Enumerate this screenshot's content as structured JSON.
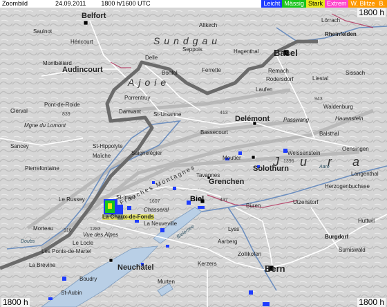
{
  "header": {
    "title": "Zoombild",
    "date": "24.09.2011",
    "time_range": "1800 h/1600 UTC"
  },
  "legend": [
    {
      "label": "Leicht",
      "color": "#1e3cff"
    },
    {
      "label": "Mässig",
      "color": "#16c41a"
    },
    {
      "label": "Stark",
      "color": "#e8e81e"
    },
    {
      "label": "Extrem",
      "color": "#ff44cc"
    },
    {
      "label": "W. Blitze",
      "color": "#ff9900"
    },
    {
      "label": "B.",
      "color": "#ff9900"
    }
  ],
  "corners": {
    "top_right": "1800 h",
    "bottom_left": "1800 h",
    "bottom_right": "1800 h"
  },
  "places": {
    "belfort": "Belfort",
    "basel": "Basel",
    "biel": "Biel",
    "bern": "Bern",
    "delemont": "Delémont",
    "neuchatel": "Neuchâtel",
    "hericourt": "Héricourt",
    "montbeliard": "Montbéliard",
    "audincourt": "Audincourt",
    "porrentruy": "Porrentruy",
    "damvant": "Damvant",
    "st_ursanne": "St-Ursanne",
    "bonfol": "Bonfol",
    "ferrette": "Ferrette",
    "seppois": "Seppois",
    "altkirch": "Altkirch",
    "hagenthal": "Hagenthal",
    "remach": "Remach",
    "rodersdorf": "Rodersdorf",
    "laufen": "Laufen",
    "liestal": "Liestal",
    "lorrach": "Lörrach",
    "rheinfelden": "Rheinfelden",
    "sissach": "Sissach",
    "waldenburg": "Waldenburg",
    "balsthal": "Balsthal",
    "weissenstein": "Weissenstein",
    "solothurn": "Solothurn",
    "grenchen": "Grenchen",
    "moutier": "Moutier",
    "bassecourt": "Bassecourt",
    "st_imier": "St-Imier",
    "chasseral": "Chasseral",
    "la_chaux_de_fonds": "La Chaux-de-Fonds",
    "le_locle": "Le Locle",
    "la_neuveville": "La Neuveville",
    "tavannes": "Tavannes",
    "saignelegier": "Saignelégier",
    "st_hippolyte": "St-Hippolyte",
    "maiche": "Maîche",
    "pierrefontaine": "Pierrefontaine",
    "le_russey": "Le Russey",
    "morteau": "Morteau",
    "pont_de_roide": "Pont-de-Roide",
    "clerval": "Clerval",
    "sancey": "Sancey",
    "langenthal": "Langenthal",
    "burgdorf": "Burgdorf",
    "buren": "Büren",
    "lyss": "Lyss",
    "aarberg": "Aarberg",
    "kerzers": "Kerzers",
    "murten": "Murten",
    "boudry": "Boudry",
    "la_brevine": "La Brévine",
    "herzogenbuchsee": "Herzogenbuchsee",
    "huttwil": "Huttwil",
    "sumiswald": "Sumiswald",
    "zollikofen": "Zollikofen",
    "utzenstorf": "Utzenstorf",
    "saulnot": "Saulnot",
    "delle": "Delle",
    "hauenstein": "Hauenstein",
    "passwang": "Passwang",
    "les_ponts": "Les Ponts-de-Martel",
    "vue_des_alpes": "Vue des Alpes",
    "st_aubin": "St-Aubin",
    "oensingen": "Oensingen"
  },
  "regions": {
    "sundgau": "Sundgau",
    "ajoie": "Ajoie",
    "franches_montagnes": "Franches Montagnes",
    "jura": "Jura",
    "mgne_du_lomont": "Mgne du Lomont"
  },
  "altitudes": {
    "a1607": "1607",
    "a1396": "1396",
    "a839": "839",
    "a943": "943",
    "a413": "413",
    "a1283": "1283",
    "a437": "437",
    "a916": "916"
  },
  "rivers": {
    "doubs": "Doubs",
    "aare": "Aare",
    "bielersee": "Bielersee"
  }
}
